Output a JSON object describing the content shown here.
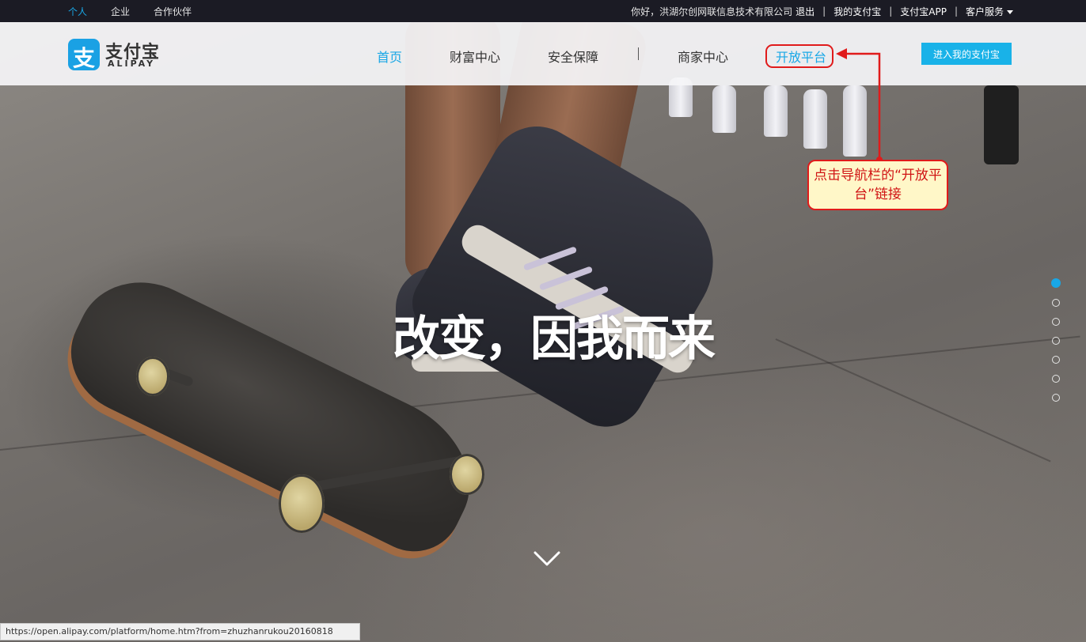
{
  "topbar": {
    "links": [
      "个人",
      "企业",
      "合作伙伴"
    ],
    "greeting": "你好，洪湖尔创网联信息技术有限公司",
    "logout": "退出",
    "my_alipay": "我的支付宝",
    "app": "支付宝APP",
    "service": "客户服务"
  },
  "nav": {
    "logo_cn": "支付宝",
    "logo_en": "ALIPAY",
    "logo_mark": "支",
    "items": [
      "首页",
      "财富中心",
      "安全保障",
      "商家中心",
      "开放平台"
    ],
    "enter_button": "进入我的支付宝"
  },
  "hero": {
    "headline": "改变，因我而来"
  },
  "carousel": {
    "total": 7,
    "active": 1
  },
  "annotation": {
    "text": "点击导航栏的“开放平台”链接"
  },
  "status": {
    "url": "https://open.alipay.com/platform/home.htm?from=zhuzhanrukou20160818"
  },
  "colors": {
    "accent": "#19a7e6",
    "annotation_red": "#e01b1b",
    "annotation_bg": "#fff7c8"
  }
}
